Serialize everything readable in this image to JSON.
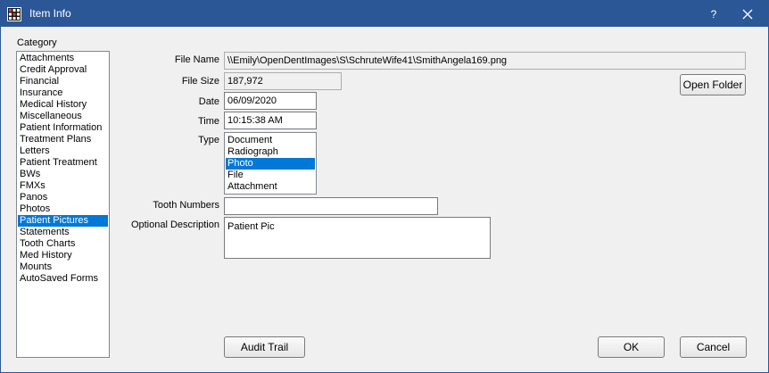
{
  "window": {
    "title": "Item Info",
    "help_label": "?",
    "title_color": "#2b5797"
  },
  "category": {
    "label": "Category",
    "items": [
      "Attachments",
      "Credit Approval",
      "Financial",
      "Insurance",
      "Medical History",
      "Miscellaneous",
      "Patient Information",
      "Treatment Plans",
      "Letters",
      "Patient Treatment",
      "BWs",
      "FMXs",
      "Panos",
      "Photos",
      "Patient Pictures",
      "Statements",
      "Tooth Charts",
      "Med History",
      "Mounts",
      "AutoSaved Forms"
    ],
    "selected": "Patient Pictures"
  },
  "form": {
    "file_name_label": "File Name",
    "file_name_value": "\\\\Emily\\OpenDentImages\\S\\SchruteWife41\\SmithAngela169.png",
    "file_size_label": "File Size",
    "file_size_value": "187,972",
    "date_label": "Date",
    "date_value": "06/09/2020",
    "time_label": "Time",
    "time_value": "10:15:38 AM",
    "type_label": "Type",
    "type_items": [
      "Document",
      "Radiograph",
      "Photo",
      "File",
      "Attachment"
    ],
    "type_selected": "Photo",
    "tooth_numbers_label": "Tooth Numbers",
    "tooth_numbers_value": "",
    "description_label": "Optional Description",
    "description_value": "Patient Pic"
  },
  "buttons": {
    "open_folder": "Open Folder",
    "audit_trail": "Audit Trail",
    "ok": "OK",
    "cancel": "Cancel"
  },
  "colors": {
    "selection": "#0078d7",
    "titlebar": "#2b5797"
  }
}
